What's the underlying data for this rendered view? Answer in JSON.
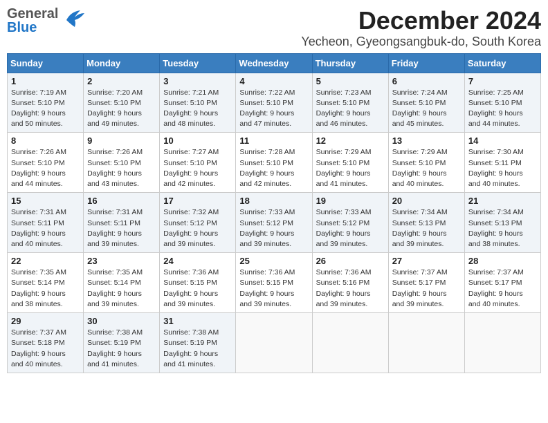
{
  "header": {
    "logo_general": "General",
    "logo_blue": "Blue",
    "title": "December 2024",
    "subtitle": "Yecheon, Gyeongsangbuk-do, South Korea"
  },
  "days_of_week": [
    "Sunday",
    "Monday",
    "Tuesday",
    "Wednesday",
    "Thursday",
    "Friday",
    "Saturday"
  ],
  "weeks": [
    [
      {
        "day": "1",
        "info": "Sunrise: 7:19 AM\nSunset: 5:10 PM\nDaylight: 9 hours\nand 50 minutes."
      },
      {
        "day": "2",
        "info": "Sunrise: 7:20 AM\nSunset: 5:10 PM\nDaylight: 9 hours\nand 49 minutes."
      },
      {
        "day": "3",
        "info": "Sunrise: 7:21 AM\nSunset: 5:10 PM\nDaylight: 9 hours\nand 48 minutes."
      },
      {
        "day": "4",
        "info": "Sunrise: 7:22 AM\nSunset: 5:10 PM\nDaylight: 9 hours\nand 47 minutes."
      },
      {
        "day": "5",
        "info": "Sunrise: 7:23 AM\nSunset: 5:10 PM\nDaylight: 9 hours\nand 46 minutes."
      },
      {
        "day": "6",
        "info": "Sunrise: 7:24 AM\nSunset: 5:10 PM\nDaylight: 9 hours\nand 45 minutes."
      },
      {
        "day": "7",
        "info": "Sunrise: 7:25 AM\nSunset: 5:10 PM\nDaylight: 9 hours\nand 44 minutes."
      }
    ],
    [
      {
        "day": "8",
        "info": "Sunrise: 7:26 AM\nSunset: 5:10 PM\nDaylight: 9 hours\nand 44 minutes."
      },
      {
        "day": "9",
        "info": "Sunrise: 7:26 AM\nSunset: 5:10 PM\nDaylight: 9 hours\nand 43 minutes."
      },
      {
        "day": "10",
        "info": "Sunrise: 7:27 AM\nSunset: 5:10 PM\nDaylight: 9 hours\nand 42 minutes."
      },
      {
        "day": "11",
        "info": "Sunrise: 7:28 AM\nSunset: 5:10 PM\nDaylight: 9 hours\nand 42 minutes."
      },
      {
        "day": "12",
        "info": "Sunrise: 7:29 AM\nSunset: 5:10 PM\nDaylight: 9 hours\nand 41 minutes."
      },
      {
        "day": "13",
        "info": "Sunrise: 7:29 AM\nSunset: 5:10 PM\nDaylight: 9 hours\nand 40 minutes."
      },
      {
        "day": "14",
        "info": "Sunrise: 7:30 AM\nSunset: 5:11 PM\nDaylight: 9 hours\nand 40 minutes."
      }
    ],
    [
      {
        "day": "15",
        "info": "Sunrise: 7:31 AM\nSunset: 5:11 PM\nDaylight: 9 hours\nand 40 minutes."
      },
      {
        "day": "16",
        "info": "Sunrise: 7:31 AM\nSunset: 5:11 PM\nDaylight: 9 hours\nand 39 minutes."
      },
      {
        "day": "17",
        "info": "Sunrise: 7:32 AM\nSunset: 5:12 PM\nDaylight: 9 hours\nand 39 minutes."
      },
      {
        "day": "18",
        "info": "Sunrise: 7:33 AM\nSunset: 5:12 PM\nDaylight: 9 hours\nand 39 minutes."
      },
      {
        "day": "19",
        "info": "Sunrise: 7:33 AM\nSunset: 5:12 PM\nDaylight: 9 hours\nand 39 minutes."
      },
      {
        "day": "20",
        "info": "Sunrise: 7:34 AM\nSunset: 5:13 PM\nDaylight: 9 hours\nand 39 minutes."
      },
      {
        "day": "21",
        "info": "Sunrise: 7:34 AM\nSunset: 5:13 PM\nDaylight: 9 hours\nand 38 minutes."
      }
    ],
    [
      {
        "day": "22",
        "info": "Sunrise: 7:35 AM\nSunset: 5:14 PM\nDaylight: 9 hours\nand 38 minutes."
      },
      {
        "day": "23",
        "info": "Sunrise: 7:35 AM\nSunset: 5:14 PM\nDaylight: 9 hours\nand 39 minutes."
      },
      {
        "day": "24",
        "info": "Sunrise: 7:36 AM\nSunset: 5:15 PM\nDaylight: 9 hours\nand 39 minutes."
      },
      {
        "day": "25",
        "info": "Sunrise: 7:36 AM\nSunset: 5:15 PM\nDaylight: 9 hours\nand 39 minutes."
      },
      {
        "day": "26",
        "info": "Sunrise: 7:36 AM\nSunset: 5:16 PM\nDaylight: 9 hours\nand 39 minutes."
      },
      {
        "day": "27",
        "info": "Sunrise: 7:37 AM\nSunset: 5:17 PM\nDaylight: 9 hours\nand 39 minutes."
      },
      {
        "day": "28",
        "info": "Sunrise: 7:37 AM\nSunset: 5:17 PM\nDaylight: 9 hours\nand 40 minutes."
      }
    ],
    [
      {
        "day": "29",
        "info": "Sunrise: 7:37 AM\nSunset: 5:18 PM\nDaylight: 9 hours\nand 40 minutes."
      },
      {
        "day": "30",
        "info": "Sunrise: 7:38 AM\nSunset: 5:19 PM\nDaylight: 9 hours\nand 41 minutes."
      },
      {
        "day": "31",
        "info": "Sunrise: 7:38 AM\nSunset: 5:19 PM\nDaylight: 9 hours\nand 41 minutes."
      },
      null,
      null,
      null,
      null
    ]
  ]
}
